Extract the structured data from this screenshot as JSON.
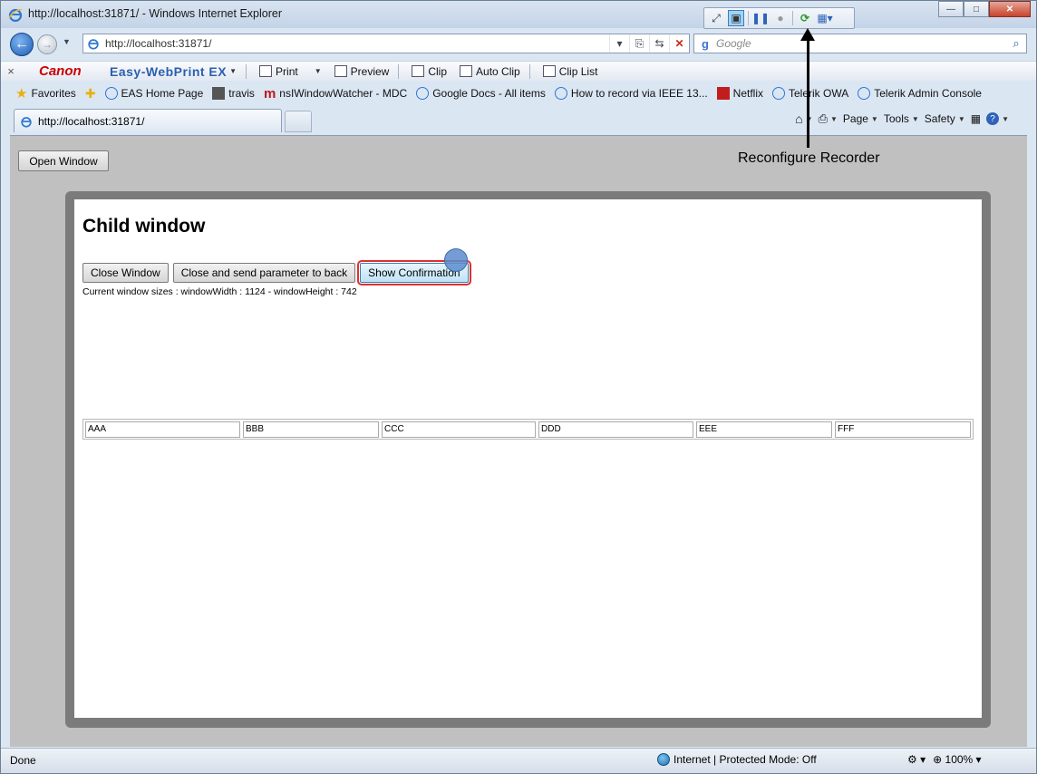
{
  "window": {
    "title": "http://localhost:31871/ - Windows Internet Explorer"
  },
  "address": {
    "url": "http://localhost:31871/"
  },
  "search": {
    "placeholder": "Google"
  },
  "canon_toolbar": {
    "brand": "Canon",
    "product": "Easy-WebPrint EX",
    "items": [
      "Print",
      "Preview",
      "Clip",
      "Auto Clip",
      "Clip List"
    ]
  },
  "favorites": {
    "label": "Favorites",
    "items": [
      "EAS Home Page",
      "travis",
      "nsIWindowWatcher - MDC",
      "Google Docs - All items",
      "How to record via IEEE 13...",
      "Netflix",
      "Telerik OWA",
      "Telerik Admin Console"
    ]
  },
  "tab": {
    "label": "http://localhost:31871/"
  },
  "command_bar": {
    "page": "Page",
    "tools": "Tools",
    "safety": "Safety"
  },
  "page": {
    "open_button": "Open Window",
    "child": {
      "title": "Child window",
      "buttons": {
        "close": "Close Window",
        "close_send": "Close and send parameter to back",
        "show": "Show Confirmation"
      },
      "sizes_text": "Current window sizes : windowWidth : 1124 - windowHeight : 742",
      "cells": [
        "AAA",
        "BBB",
        "CCC",
        "DDD",
        "EEE",
        "FFF"
      ]
    }
  },
  "annotation": "Reconfigure Recorder",
  "status": {
    "left": "Done",
    "zone": "Internet | Protected Mode: Off",
    "zoom": "100%"
  }
}
